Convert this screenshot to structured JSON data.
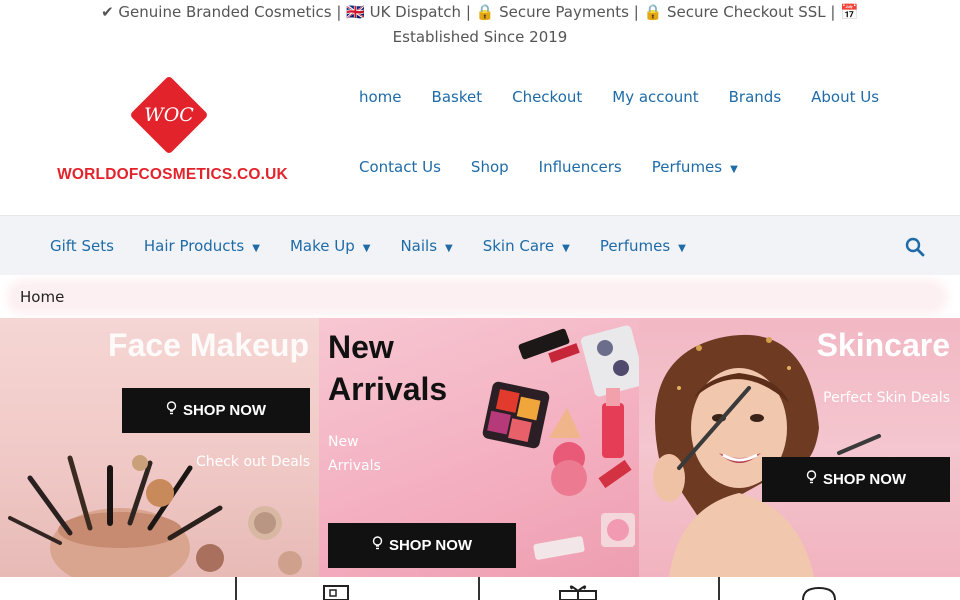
{
  "topbar": {
    "announcement": "✔ Genuine Branded Cosmetics | 🇬🇧 UK Dispatch | 🔒 Secure Payments | 🔒 Secure Checkout SSL | 📅 Established Since 2019"
  },
  "logo": {
    "mark": "WOC",
    "text": "WORLDOFCOSMETICS.CO.UK",
    "color": "#e3232b"
  },
  "primary_nav": {
    "row1": [
      "home",
      "Basket",
      "Checkout",
      "My account",
      "Brands",
      "About Us"
    ],
    "row2": [
      "Contact Us",
      "Shop",
      "Influencers",
      "Perfumes"
    ]
  },
  "category_nav": {
    "items": [
      "Gift Sets",
      "Hair Products",
      "Make Up",
      "Nails",
      "Skin Care",
      "Perfumes"
    ],
    "search_icon": "search-icon"
  },
  "breadcrumb": {
    "current": "Home"
  },
  "banners": [
    {
      "headline": "Face Makeup",
      "button": "SHOP NOW",
      "subtext": "Check out Deals"
    },
    {
      "headline": "New Arrivals",
      "subtext": "New Arrivals",
      "button": "SHOP NOW"
    },
    {
      "headline": "Skincare",
      "subtext": "Perfect Skin Deals",
      "button": "SHOP NOW"
    }
  ],
  "colors": {
    "link": "#1e6ba8",
    "brand_red": "#e3232b",
    "button_bg": "#111111"
  }
}
